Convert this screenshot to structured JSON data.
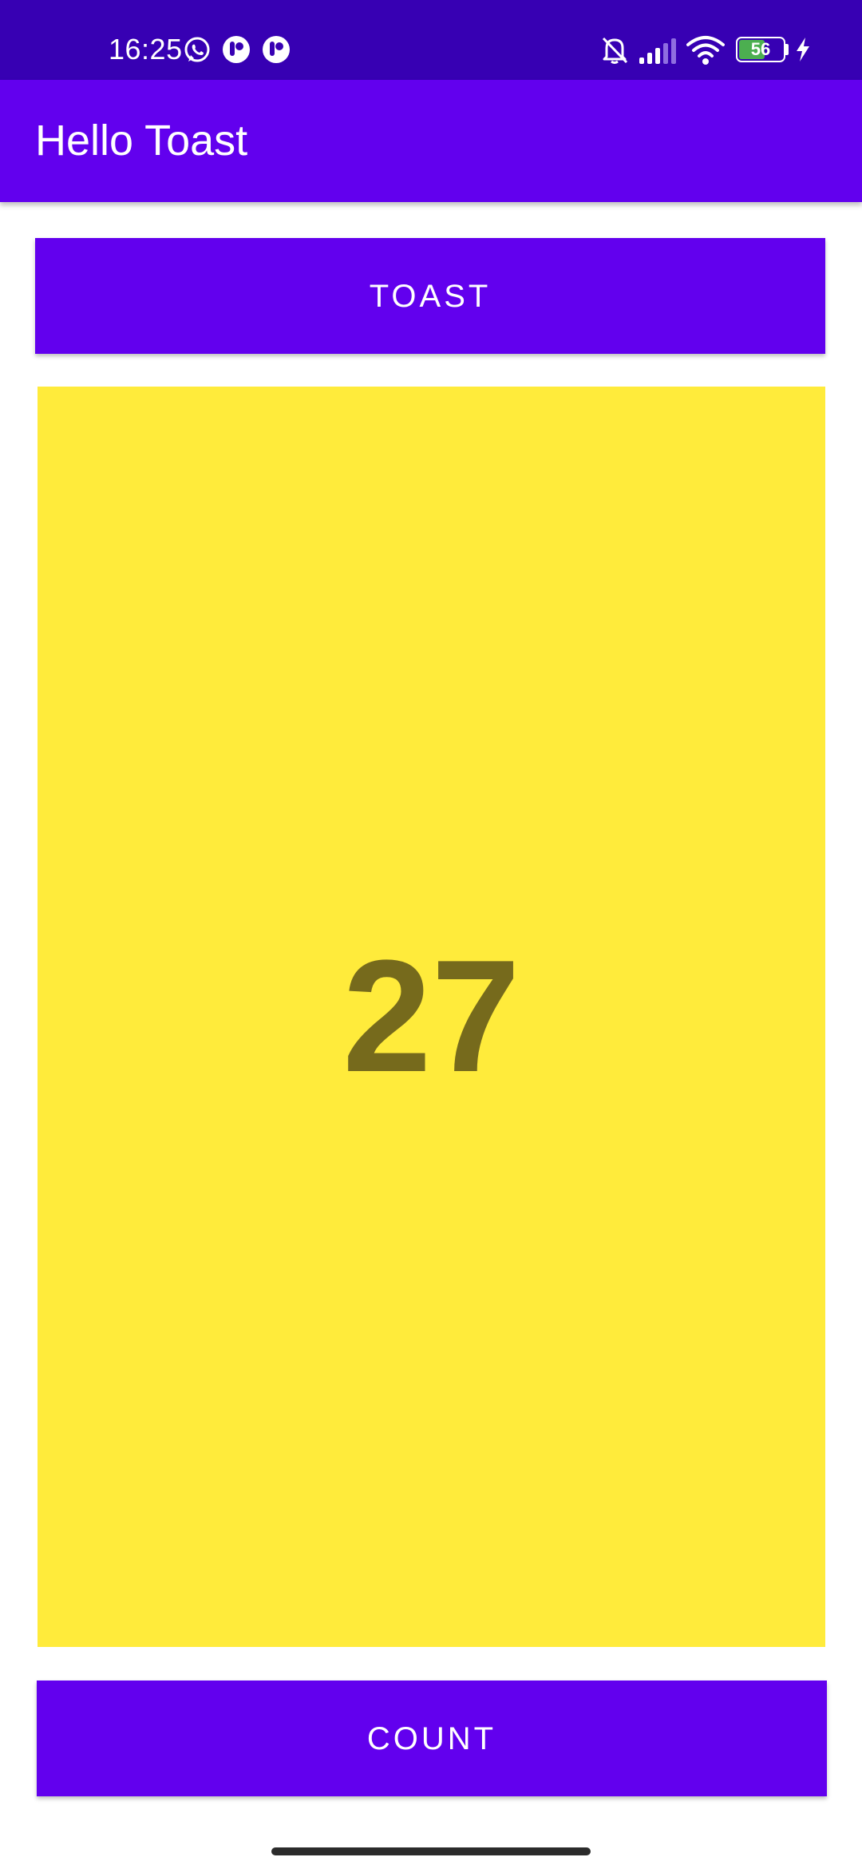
{
  "status_bar": {
    "time": "16:25",
    "battery_level": "56",
    "left_icons": [
      "whatsapp-icon",
      "app-icon",
      "app-icon"
    ],
    "right_icons": [
      "bell-off-icon",
      "signal-icon",
      "wifi-icon",
      "battery-icon",
      "charging-icon"
    ]
  },
  "app_bar": {
    "title": "Hello Toast"
  },
  "buttons": {
    "toast_label": "TOAST",
    "count_label": "COUNT"
  },
  "counter": {
    "value": "27"
  },
  "colors": {
    "status_bar": "#3700b3",
    "primary": "#6200ee",
    "panel": "#ffeb3b",
    "count_text": "#766a1c"
  }
}
